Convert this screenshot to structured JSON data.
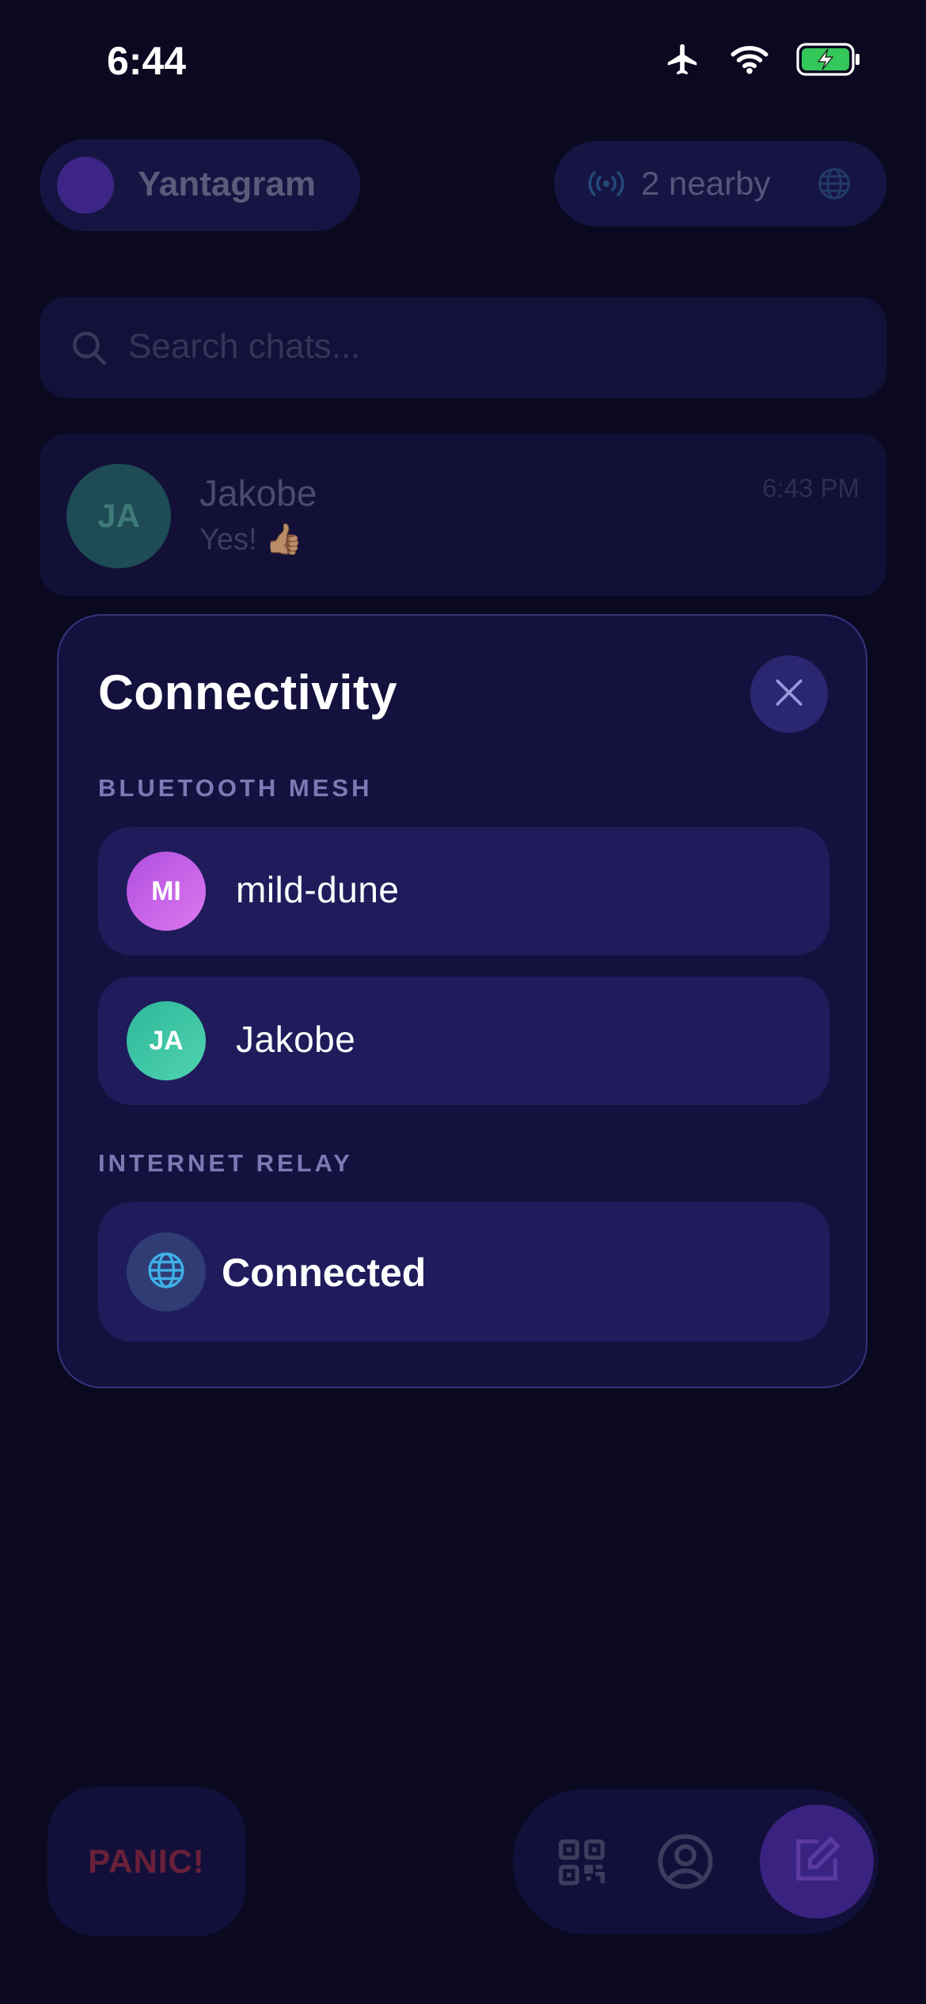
{
  "status_bar": {
    "time": "6:44"
  },
  "background_app": {
    "brand_name": "Yantagram",
    "nearby_label": "2 nearby",
    "search_placeholder": "Search chats...",
    "chat": {
      "initials": "JA",
      "name": "Jakobe",
      "preview": "Yes! 👍🏽",
      "time": "6:43 PM"
    },
    "panic_label": "PANIC!"
  },
  "modal": {
    "title": "Connectivity",
    "bluetooth_section": {
      "label": "BLUETOOTH MESH",
      "peers": [
        {
          "initials": "MI",
          "name": "mild-dune",
          "color": "#c863e6"
        },
        {
          "initials": "JA",
          "name": "Jakobe",
          "color": "#3fc7a4"
        }
      ]
    },
    "internet_section": {
      "label": "INTERNET RELAY",
      "status": "Connected"
    }
  },
  "colors": {
    "accent": "#6f3fd9",
    "modal_bg": "#15113e",
    "row_bg": "#201c5c",
    "battery_green": "#34c759",
    "relay_icon": "#3fb0e8"
  }
}
